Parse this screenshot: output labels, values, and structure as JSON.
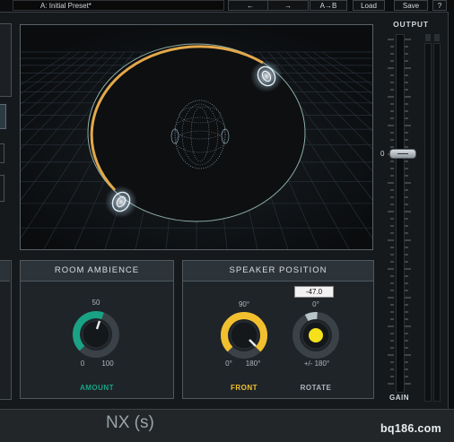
{
  "toolbar": {
    "preset_name": "A: Initial Preset*",
    "undo_label": "←",
    "redo_label": "→",
    "ab_label": "A→B",
    "load_label": "Load",
    "save_label": "Save",
    "help_label": "?"
  },
  "room_ambience": {
    "title": "ROOM AMBIENCE",
    "value_label": "50",
    "min_label": "0",
    "max_label": "100",
    "footer": "AMOUNT",
    "value": 50,
    "accent_color": "#19a384"
  },
  "speaker_position": {
    "title": "SPEAKER POSITION",
    "front": {
      "value_label": "90°",
      "min_label": "0°",
      "max_label": "180°",
      "footer": "FRONT",
      "accent_color": "#f2c02e"
    },
    "rotate": {
      "readout": "-47.0",
      "value_label": "0°",
      "range_label": "+/- 180°",
      "footer": "ROTATE",
      "accent_color": "#f4e11c"
    }
  },
  "output": {
    "title": "OUTPUT",
    "zero_label": "0",
    "footer": "GAIN"
  },
  "footer": {
    "product_name": "NX (s)",
    "watermark": "bq186.com"
  }
}
